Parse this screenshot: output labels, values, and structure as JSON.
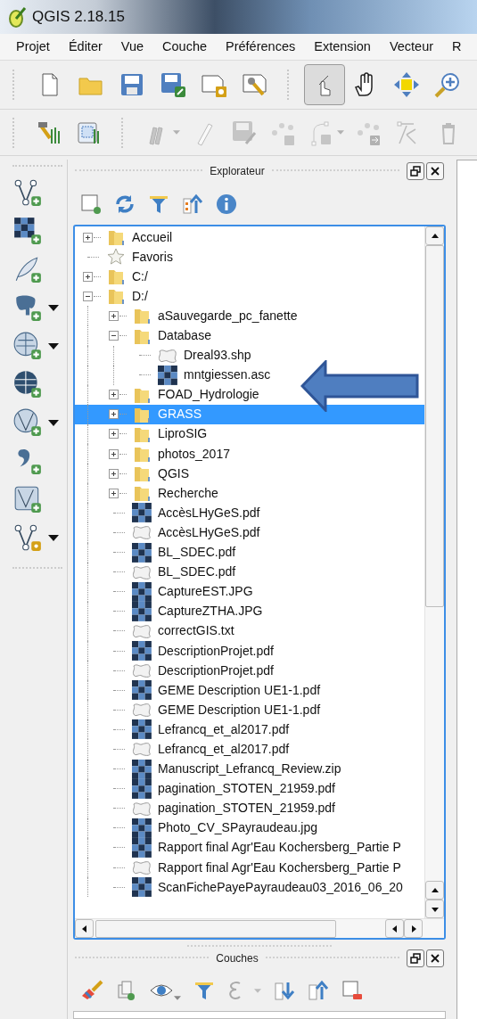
{
  "window": {
    "title": "QGIS 2.18.15"
  },
  "menu": [
    "Projet",
    "Éditer",
    "Vue",
    "Couche",
    "Préférences",
    "Extension",
    "Vecteur",
    "R"
  ],
  "toolbar_1": [
    {
      "kind": "new-file",
      "active": false
    },
    {
      "kind": "open",
      "active": false
    },
    {
      "kind": "save",
      "active": false
    },
    {
      "kind": "save-as",
      "active": false
    },
    {
      "kind": "new-layout",
      "active": false
    },
    {
      "kind": "layout-manager",
      "active": false
    },
    {
      "kind": "touch",
      "active": true
    },
    {
      "kind": "pan",
      "active": false
    },
    {
      "kind": "pan-selection",
      "active": false
    },
    {
      "kind": "zoom-in",
      "active": false
    }
  ],
  "toolbar_2": [
    {
      "kind": "grass-tools",
      "disabled": false,
      "dropdown": false
    },
    {
      "kind": "grass-map",
      "disabled": false,
      "dropdown": false
    },
    {
      "kind": "pencils",
      "disabled": true,
      "dropdown": true
    },
    {
      "kind": "pencil",
      "disabled": true,
      "dropdown": false
    },
    {
      "kind": "save-edits",
      "disabled": true,
      "dropdown": false
    },
    {
      "kind": "add-points",
      "disabled": true,
      "dropdown": false
    },
    {
      "kind": "node-tool",
      "disabled": true,
      "dropdown": true
    },
    {
      "kind": "move-points",
      "disabled": true,
      "dropdown": false
    },
    {
      "kind": "cut",
      "disabled": true,
      "dropdown": false
    },
    {
      "kind": "trash",
      "disabled": true,
      "dropdown": false
    }
  ],
  "layer_toolbar": [
    {
      "kind": "add-vector",
      "dropdown": false
    },
    {
      "kind": "add-raster",
      "dropdown": false
    },
    {
      "kind": "add-text",
      "dropdown": false
    },
    {
      "kind": "add-postgis",
      "dropdown": true
    },
    {
      "kind": "add-wms",
      "dropdown": true
    },
    {
      "kind": "add-wcs",
      "dropdown": false
    },
    {
      "kind": "add-wfs",
      "dropdown": true
    },
    {
      "kind": "add-spatialite",
      "dropdown": false
    },
    {
      "kind": "add-virtual",
      "dropdown": false
    },
    {
      "kind": "new-layer",
      "dropdown": true
    }
  ],
  "browser": {
    "title": "Explorateur",
    "tree": [
      {
        "label": "Accueil",
        "kind": "folder",
        "expanded": false,
        "selected": false
      },
      {
        "label": "Favoris",
        "kind": "favorites",
        "selected": false
      },
      {
        "label": "C:/",
        "kind": "folder",
        "expanded": false,
        "selected": false
      },
      {
        "label": "D:/",
        "kind": "folder",
        "expanded": true,
        "selected": false,
        "children": [
          {
            "label": "aSauvegarde_pc_fanette",
            "kind": "folder",
            "expanded": false,
            "selected": false
          },
          {
            "label": "Database",
            "kind": "folder",
            "expanded": true,
            "selected": false,
            "children": [
              {
                "label": "Dreal93.shp",
                "kind": "vector",
                "selected": false
              },
              {
                "label": "mntgiessen.asc",
                "kind": "raster",
                "selected": false
              }
            ]
          },
          {
            "label": "FOAD_Hydrologie",
            "kind": "folder",
            "expanded": false,
            "selected": false
          },
          {
            "label": "GRASS",
            "kind": "folder",
            "expanded": false,
            "selected": true
          },
          {
            "label": "LiproSIG",
            "kind": "folder",
            "expanded": false,
            "selected": false
          },
          {
            "label": "photos_2017",
            "kind": "folder",
            "expanded": false,
            "selected": false
          },
          {
            "label": "QGIS",
            "kind": "folder",
            "expanded": false,
            "selected": false
          },
          {
            "label": "Recherche",
            "kind": "folder",
            "expanded": false,
            "selected": false
          },
          {
            "label": "AccèsLHyGeS.pdf",
            "kind": "raster",
            "selected": false
          },
          {
            "label": "AccèsLHyGeS.pdf",
            "kind": "vector",
            "selected": false
          },
          {
            "label": "BL_SDEC.pdf",
            "kind": "raster",
            "selected": false
          },
          {
            "label": "BL_SDEC.pdf",
            "kind": "vector",
            "selected": false
          },
          {
            "label": "CaptureEST.JPG",
            "kind": "raster",
            "selected": false
          },
          {
            "label": "CaptureZTHA.JPG",
            "kind": "raster",
            "selected": false
          },
          {
            "label": "correctGIS.txt",
            "kind": "vector",
            "selected": false
          },
          {
            "label": "DescriptionProjet.pdf",
            "kind": "raster",
            "selected": false
          },
          {
            "label": "DescriptionProjet.pdf",
            "kind": "vector",
            "selected": false
          },
          {
            "label": "GEME Description UE1-1.pdf",
            "kind": "raster",
            "selected": false
          },
          {
            "label": "GEME Description UE1-1.pdf",
            "kind": "vector",
            "selected": false
          },
          {
            "label": "Lefrancq_et_al2017.pdf",
            "kind": "raster",
            "selected": false
          },
          {
            "label": "Lefrancq_et_al2017.pdf",
            "kind": "vector",
            "selected": false
          },
          {
            "label": "Manuscript_Lefrancq_Review.zip",
            "kind": "raster",
            "selected": false
          },
          {
            "label": "pagination_STOTEN_21959.pdf",
            "kind": "raster",
            "selected": false
          },
          {
            "label": "pagination_STOTEN_21959.pdf",
            "kind": "vector",
            "selected": false
          },
          {
            "label": "Photo_CV_SPayraudeau.jpg",
            "kind": "raster",
            "selected": false
          },
          {
            "label": "Rapport final Agr'Eau Kochersberg_Partie P",
            "kind": "raster",
            "selected": false
          },
          {
            "label": "Rapport final Agr'Eau Kochersberg_Partie P",
            "kind": "vector",
            "selected": false
          },
          {
            "label": "ScanFichePayePayraudeau03_2016_06_20",
            "kind": "raster",
            "selected": false
          }
        ]
      }
    ]
  },
  "layers_panel": {
    "title": "Couches"
  }
}
